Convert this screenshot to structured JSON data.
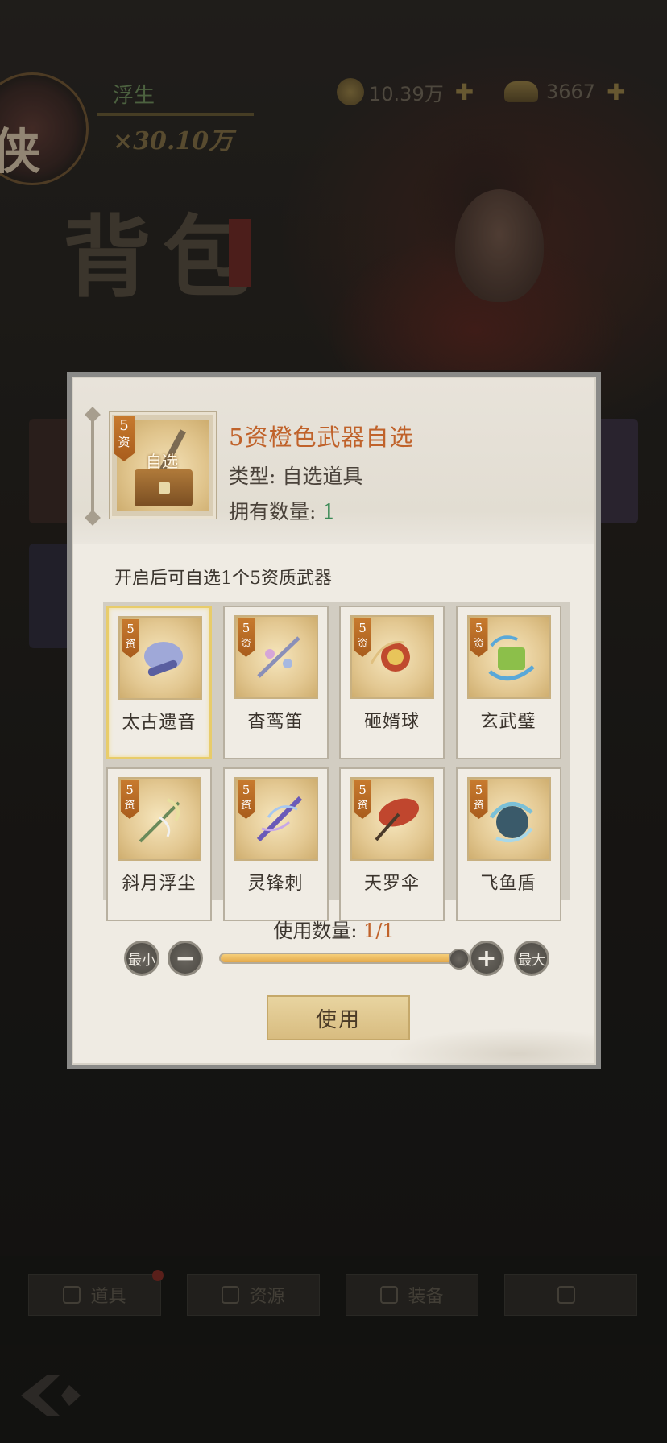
{
  "background": {
    "player_name": "浮生",
    "power": "×30.10万",
    "currency_coins": "10.39万",
    "currency_ingots": "3667",
    "page_title": "背包",
    "bottom_tabs": [
      "道具",
      "资源",
      "装备",
      ""
    ]
  },
  "modal": {
    "item": {
      "grade_number": "5",
      "grade_char": "资",
      "art_label": "自选",
      "title": "5资橙色武器自选",
      "type_label": "类型: ",
      "type_value": "自选道具",
      "owned_label": "拥有数量: ",
      "owned_value": "1"
    },
    "description": "开启后可自选1个5资质武器",
    "options": [
      {
        "name": "太古遗音",
        "grade": "5",
        "grade_char": "资",
        "selected": true
      },
      {
        "name": "杳鸾笛",
        "grade": "5",
        "grade_char": "资",
        "selected": false
      },
      {
        "name": "砸婿球",
        "grade": "5",
        "grade_char": "资",
        "selected": false
      },
      {
        "name": "玄武璧",
        "grade": "5",
        "grade_char": "资",
        "selected": false
      },
      {
        "name": "斜月浮尘",
        "grade": "5",
        "grade_char": "资",
        "selected": false
      },
      {
        "name": "灵锋刺",
        "grade": "5",
        "grade_char": "资",
        "selected": false
      },
      {
        "name": "天罗伞",
        "grade": "5",
        "grade_char": "资",
        "selected": false
      },
      {
        "name": "飞鱼盾",
        "grade": "5",
        "grade_char": "资",
        "selected": false
      }
    ],
    "quantity": {
      "label": "使用数量: ",
      "value": "1/1",
      "fraction": 1.0
    },
    "controls": {
      "min_label": "最小",
      "minus_symbol": "−",
      "plus_symbol": "+",
      "max_label": "最大"
    },
    "use_button_label": "使用"
  },
  "colors": {
    "title_orange": "#c0622a",
    "owned_green": "#3a8a55",
    "grade_tag": "#c77a2e",
    "selected_border": "#e8cc6a",
    "slider_fill": "#e3a84a"
  }
}
